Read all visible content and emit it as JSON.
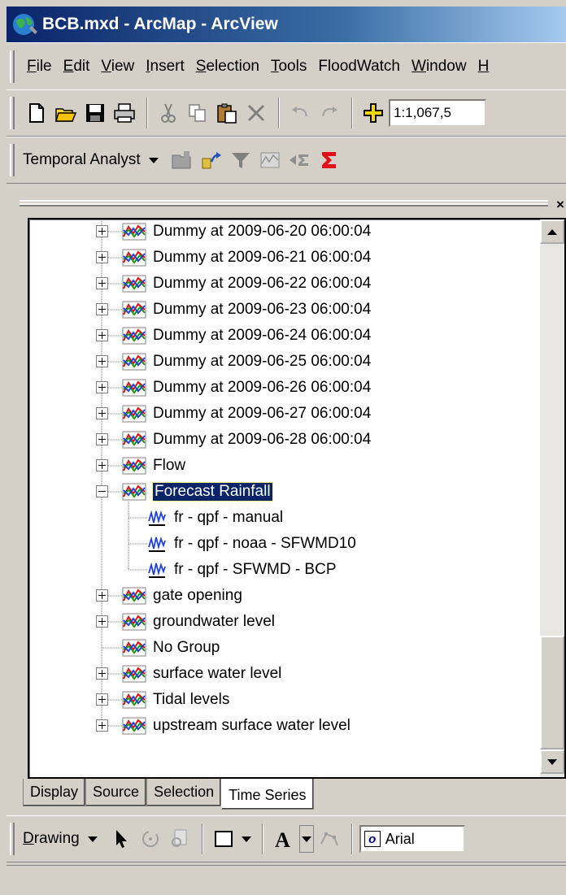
{
  "window": {
    "title": "BCB.mxd - ArcMap - ArcView"
  },
  "menu": [
    {
      "label": "File",
      "u": "F",
      "rest": "ile"
    },
    {
      "label": "Edit",
      "u": "E",
      "rest": "dit"
    },
    {
      "label": "View",
      "u": "V",
      "rest": "iew"
    },
    {
      "label": "Insert",
      "u": "I",
      "rest": "nsert"
    },
    {
      "label": "Selection",
      "u": "S",
      "rest": "election"
    },
    {
      "label": "Tools",
      "u": "T",
      "rest": "ools"
    },
    {
      "label": "FloodWatch",
      "u": "",
      "rest": "FloodWatch"
    },
    {
      "label": "Window",
      "u": "W",
      "rest": "indow"
    },
    {
      "label": "H",
      "u": "H",
      "rest": ""
    }
  ],
  "standard_toolbar": {
    "scale_value": "1:1,067,5"
  },
  "temporal_toolbar": {
    "label": "Temporal Analyst"
  },
  "tree": {
    "groups_top": [
      "Dummy at 2009-06-20 06:00:04",
      "Dummy at 2009-06-21 06:00:04",
      "Dummy at 2009-06-22 06:00:04",
      "Dummy at 2009-06-23 06:00:04",
      "Dummy at 2009-06-24 06:00:04",
      "Dummy at 2009-06-25 06:00:04",
      "Dummy at 2009-06-26 06:00:04",
      "Dummy at 2009-06-27 06:00:04",
      "Dummy at 2009-06-28 06:00:04",
      "Flow"
    ],
    "selected_group": "Forecast Rainfall",
    "children": [
      "fr - qpf - manual",
      "fr - qpf - noaa - SFWMD10",
      "fr - qpf - SFWMD - BCP"
    ],
    "groups_bottom": [
      "gate opening",
      "groundwater level",
      "No Group",
      "surface water level",
      "Tidal levels",
      "upstream surface water level"
    ]
  },
  "tabs": [
    "Display",
    "Source",
    "Selection",
    "Time Series"
  ],
  "drawing_toolbar": {
    "label_u": "D",
    "label_rest": "rawing",
    "font": "Arial"
  }
}
